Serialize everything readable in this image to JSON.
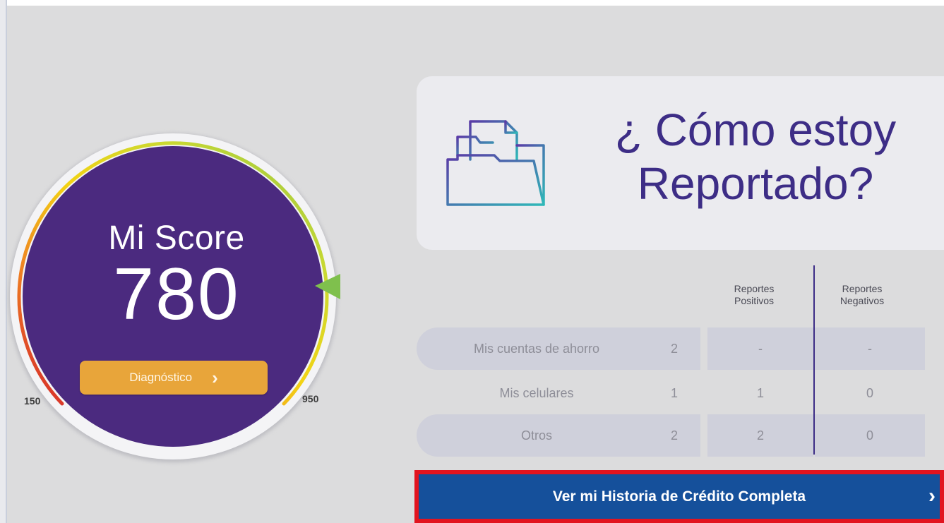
{
  "score": {
    "title": "Mi Score",
    "value": "780",
    "min_label": "150",
    "max_label": "950",
    "diagnostic_button": "Diagnóstico",
    "chevron_glyph": "›"
  },
  "report": {
    "title_line1": "¿ Cómo estoy",
    "title_line2": "Reportado?",
    "icon": "folder-document-icon"
  },
  "table": {
    "headers": {
      "positive_line1": "Reportes",
      "positive_line2": "Positivos",
      "negative_line1": "Reportes",
      "negative_line2": "Negativos"
    },
    "rows": [
      {
        "label": "Mis cuentas de ahorro",
        "count": "2",
        "positive": "-",
        "negative": "-"
      },
      {
        "label": "Mis celulares",
        "count": "1",
        "positive": "1",
        "negative": "0"
      },
      {
        "label": "Otros",
        "count": "2",
        "positive": "2",
        "negative": "0"
      }
    ]
  },
  "history_button": {
    "label": "Ver mi Historia de Crédito Completa",
    "chevron_glyph": "›"
  },
  "colors": {
    "brand_purple": "#4b2a7f",
    "accent_orange": "#e8a53a",
    "button_blue": "#15509b",
    "highlight_red": "#e2141f"
  }
}
